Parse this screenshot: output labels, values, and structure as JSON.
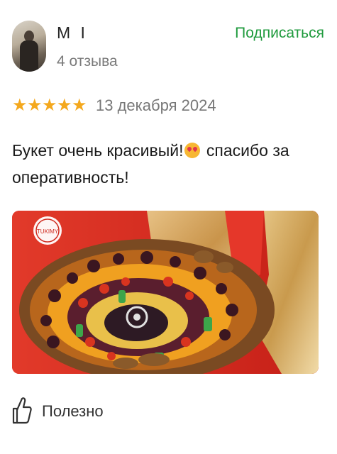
{
  "review": {
    "author": "M I",
    "review_count": "4 отзыва",
    "subscribe_label": "Подписаться",
    "rating": 5,
    "rating_max": 5,
    "date": "13 декабря 2024",
    "text_part1": "Букет очень красивый!",
    "emoji": "smiling-face-with-heart-eyes-cat",
    "text_part2": " спасибо за оперативность!",
    "photo_logo_text": "TUKIMY",
    "helpful_label": "Полезно"
  },
  "colors": {
    "subscribe": "#1e9a3c",
    "star": "#f4a81d",
    "date": "#777777",
    "photo_background": "#d42a1e"
  }
}
